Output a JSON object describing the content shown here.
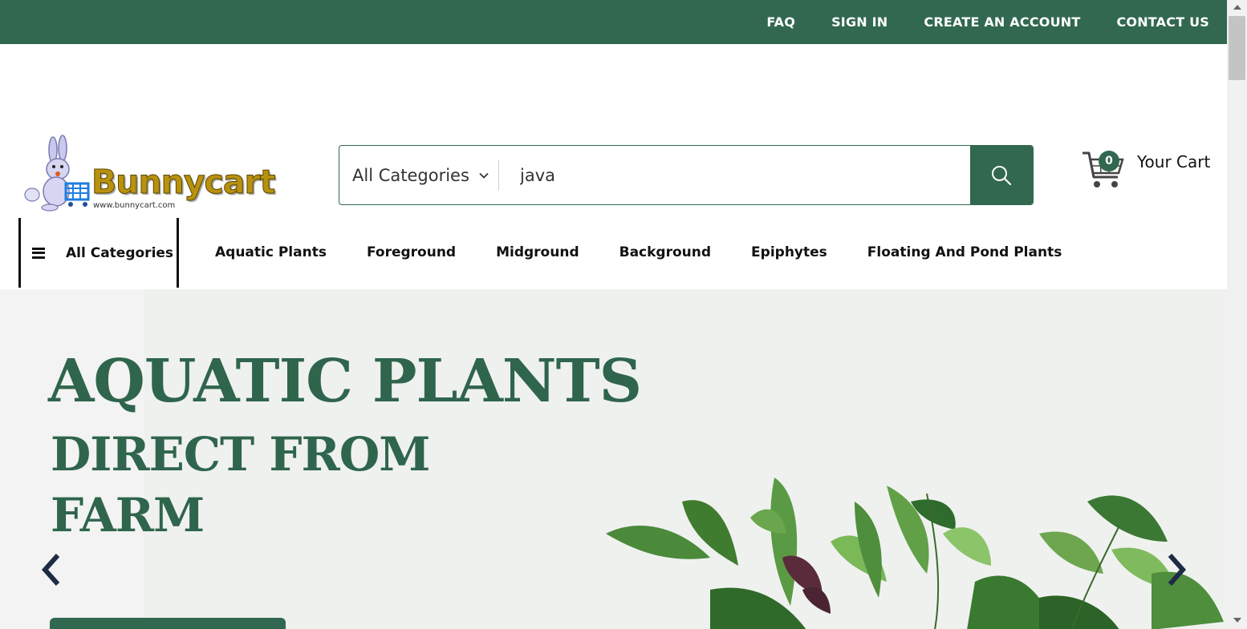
{
  "topbar": {
    "links": [
      "FAQ",
      "SIGN IN",
      "CREATE AN ACCOUNT",
      "CONTACT US"
    ]
  },
  "logo": {
    "name": "Bunnycart",
    "url_text": "www.bunnycart.com"
  },
  "search": {
    "category_label": "All Categories",
    "query": "java",
    "button_icon": "search-icon"
  },
  "cart": {
    "count": "0",
    "label": "Your Cart",
    "icon": "cart-icon"
  },
  "nav": {
    "all_categories": "All Categories",
    "links": [
      "Aquatic Plants",
      "Foreground",
      "Midground",
      "Background",
      "Epiphytes",
      "Floating And Pond Plants"
    ]
  },
  "hero": {
    "headline": "AQUATIC PLANTS",
    "line2": "DIRECT FROM",
    "line3": "FARM"
  },
  "colors": {
    "brand": "#31684f",
    "hero_bg": "#eff1ef"
  }
}
